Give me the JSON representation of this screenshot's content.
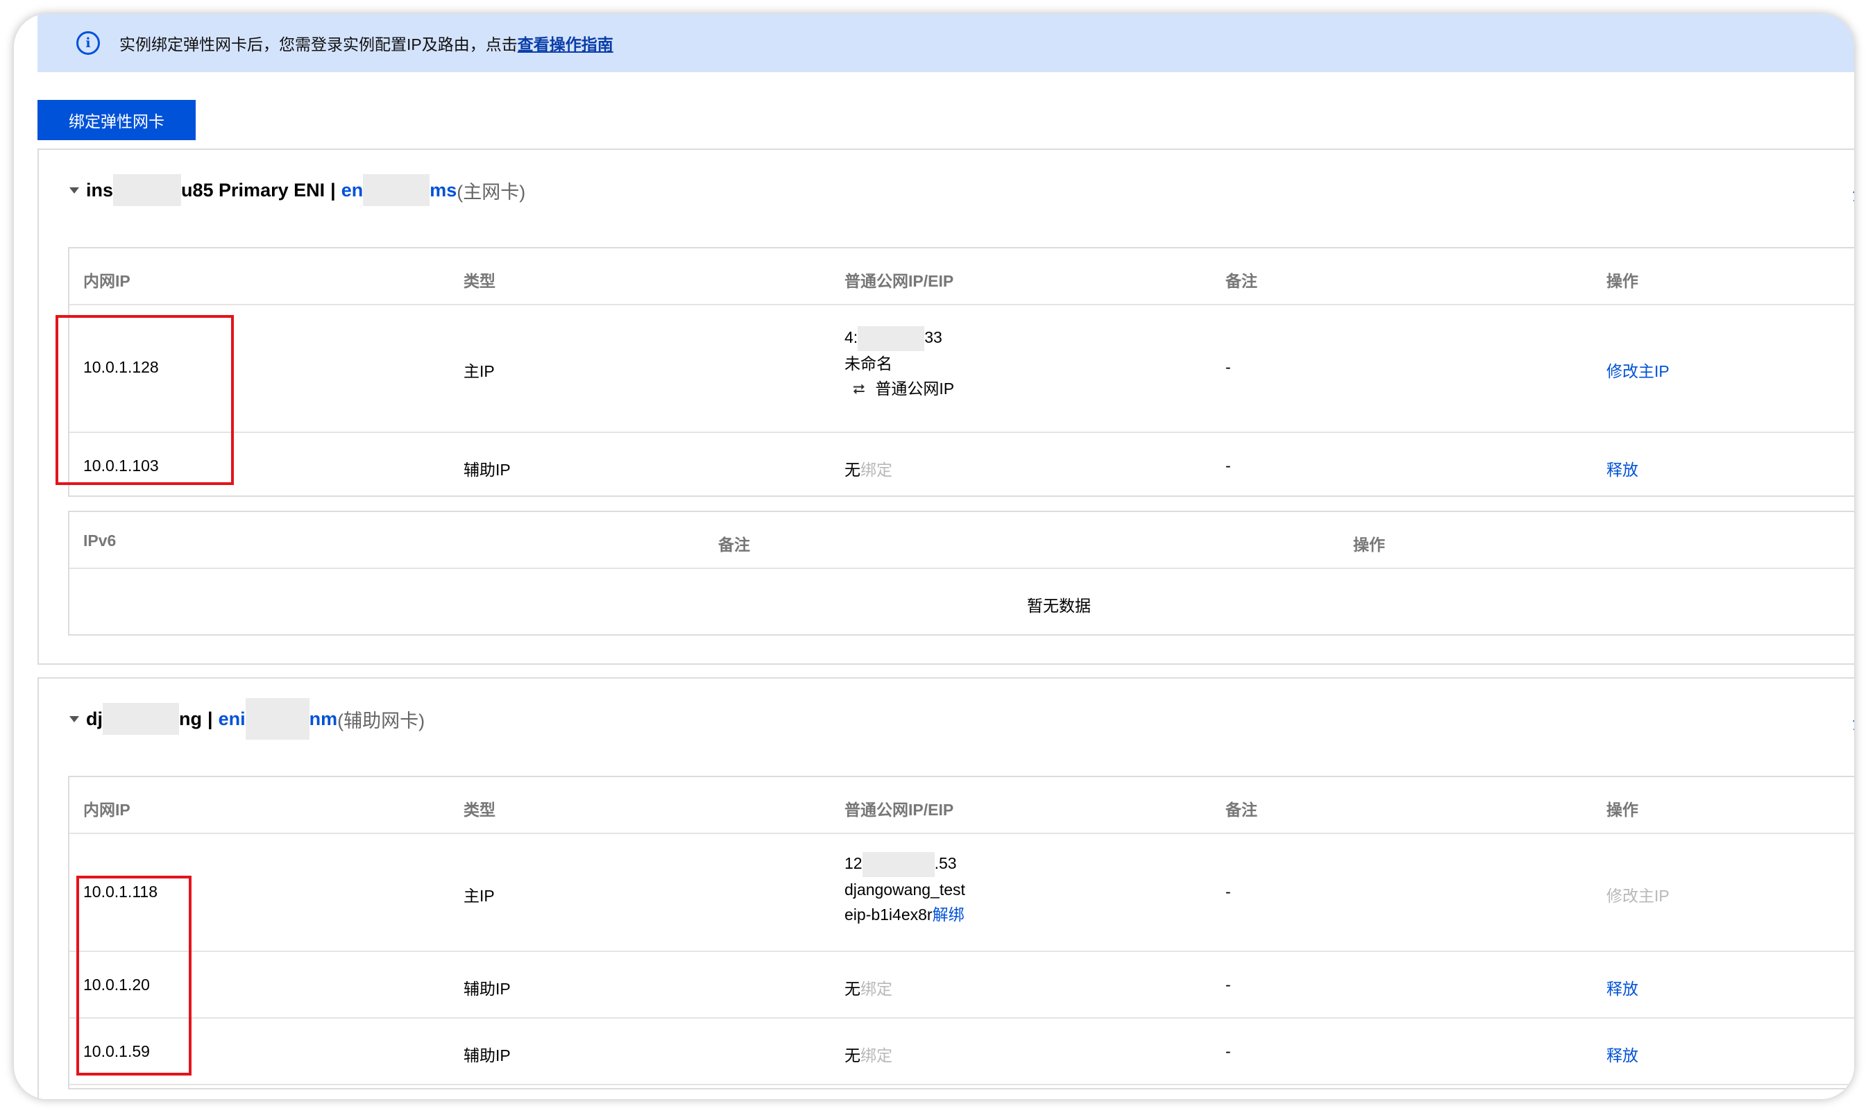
{
  "notice": {
    "text": "实例绑定弹性网卡后，您需登录实例配置IP及路由，点击",
    "link": "查看操作指南"
  },
  "bind_button": "绑定弹性网卡",
  "columns": {
    "private_ip": "内网IP",
    "type": "类型",
    "public_ip": "普通公网IP/EIP",
    "remark": "备注",
    "action": "操作"
  },
  "ipv6_columns": {
    "ipv6": "IPv6",
    "remark": "备注",
    "action": "操作"
  },
  "cards": [
    {
      "title_a": "ins",
      "title_b": "u85 Primary ENI",
      "sep": "|",
      "eni_a": "en",
      "eni_b": "ms",
      "role": "(主网卡)",
      "edge_text": "分",
      "rows": [
        {
          "ip": "10.0.1.128",
          "type": "主IP",
          "pub_a": "4:",
          "pub_b": "33",
          "pub_name": "未命名",
          "pub_kind": "普通公网IP",
          "remark": "-",
          "action": "修改主IP"
        },
        {
          "ip": "10.0.1.103",
          "type": "辅助IP",
          "none": "无",
          "unbound": "绑定",
          "remark": "-",
          "action": "释放"
        }
      ],
      "ipv6_empty": "暂无数据"
    },
    {
      "title_a": "dj",
      "title_b": "ng",
      "sep": "|",
      "eni_a": "eni",
      "eni_b": "nm",
      "role": "(辅助网卡)",
      "edge_text": "分",
      "rows": [
        {
          "ip": "10.0.1.118",
          "type": "主IP",
          "pub_a": "12",
          "pub_b": ".53",
          "pub_name": "djangowang_test",
          "eip_id": "eip-b1i4ex8r",
          "unbind": "解绑",
          "remark": "-",
          "action": "修改主IP"
        },
        {
          "ip": "10.0.1.20",
          "type": "辅助IP",
          "none": "无",
          "unbound": "绑定",
          "remark": "-",
          "action": "释放"
        },
        {
          "ip": "10.0.1.59",
          "type": "辅助IP",
          "none": "无",
          "unbound": "绑定",
          "remark": "-",
          "action": "释放"
        }
      ]
    }
  ],
  "colors": {
    "primary": "#0052d9",
    "notice_bg": "#d4e3fc",
    "highlight": "#e3141c"
  },
  "icons": {
    "info": "info-circle-icon",
    "caret": "caret-down-icon",
    "exchange": "exchange-icon"
  }
}
